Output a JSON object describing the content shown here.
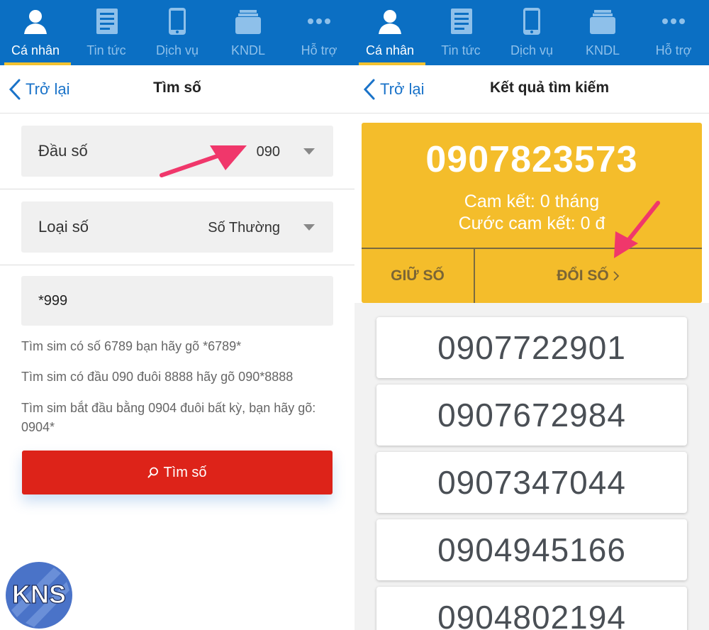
{
  "nav": {
    "tabs": [
      {
        "label": "Cá nhân",
        "icon": "person-icon",
        "active": true
      },
      {
        "label": "Tin tức",
        "icon": "news-icon",
        "active": false
      },
      {
        "label": "Dịch vụ",
        "icon": "phone-icon",
        "active": false
      },
      {
        "label": "KNDL",
        "icon": "folder-icon",
        "active": false
      },
      {
        "label": "Hỗ trợ",
        "icon": "more-icon",
        "active": false
      }
    ]
  },
  "left": {
    "header": {
      "back_label": "Trở lại",
      "title": "Tìm số"
    },
    "prefix_field": {
      "label": "Đầu số",
      "value": "090"
    },
    "type_field": {
      "label": "Loại số",
      "value": "Số Thường"
    },
    "search": {
      "value": "*999"
    },
    "hints": [
      "Tìm sim có số 6789 bạn hãy gõ *6789*",
      "Tìm sim có đầu 090 đuôi 8888 hãy gõ 090*8888",
      "Tìm sim bắt đầu bằng 0904 đuôi bất kỳ, bạn hãy gõ: 0904*"
    ],
    "search_button": {
      "label": "Tìm số",
      "icon": "search-icon"
    }
  },
  "right": {
    "header": {
      "back_label": "Trở lại",
      "title": "Kết quả tìm kiếm"
    },
    "selected": {
      "number": "0907823573",
      "commitment": "Cam kết: 0 tháng",
      "fee": "Cước cam kết: 0 đ",
      "keep_label": "GIỮ SỐ",
      "change_label": "ĐỔI SỐ"
    },
    "results": [
      "0907722901",
      "0907672984",
      "0907347044",
      "0904945166",
      "0904802194"
    ]
  },
  "watermark": {
    "text": "KNS"
  },
  "colors": {
    "nav_bg": "#0b6fc3",
    "nav_active_underline": "#f2c230",
    "card_bg": "#f4bd2b",
    "search_button_bg": "#dd2319",
    "arrow": "#f0376b"
  }
}
